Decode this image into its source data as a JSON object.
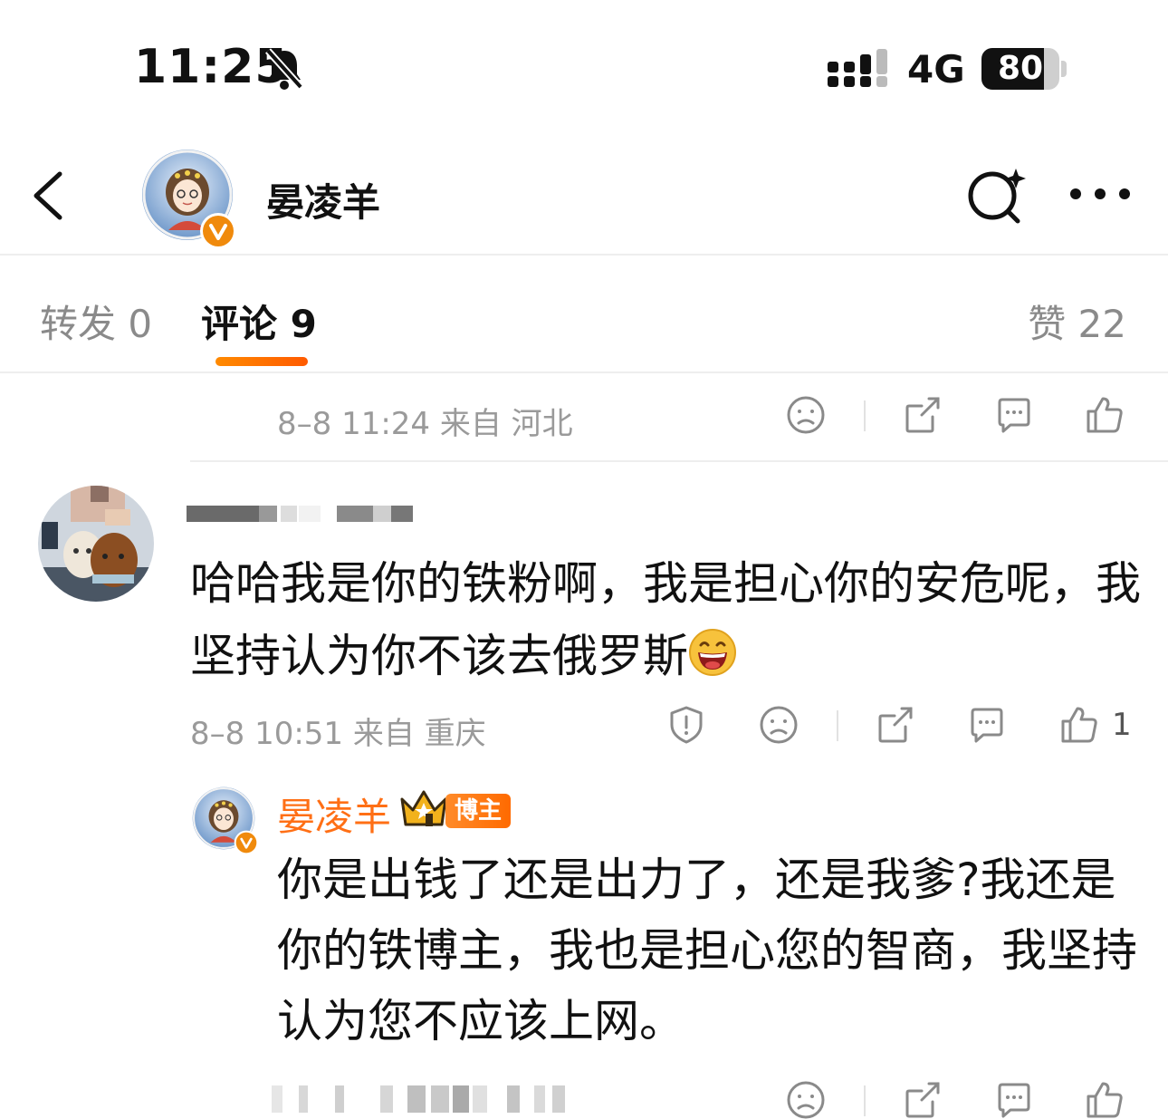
{
  "status_bar": {
    "time": "11:25",
    "network": "4G",
    "battery": "80",
    "battery_level": 0.8
  },
  "header": {
    "name": "晏凌羊"
  },
  "tabs": {
    "repost": "转发 0",
    "comment": "评论 9",
    "like": "赞 22"
  },
  "previous_comment": {
    "meta": "8–8 11:24 来自 河北"
  },
  "comment": {
    "text": "哈哈我是你的铁粉啊，我是担心你的安危呢，我坚持认为你不该去俄罗斯",
    "meta": "8–8 10:51 来自 重庆",
    "like_count": "1"
  },
  "reply": {
    "name": "晏凌羊",
    "badge": "博主",
    "text": "你是出钱了还是出力了，还是我爹?我还是你的铁博主，我也是担心您的智商，我坚持认为您不应该上网。"
  },
  "colors": {
    "accent": "#ff6f15",
    "verified": "#f08a0c",
    "meta_gray": "#9a9a9a"
  }
}
